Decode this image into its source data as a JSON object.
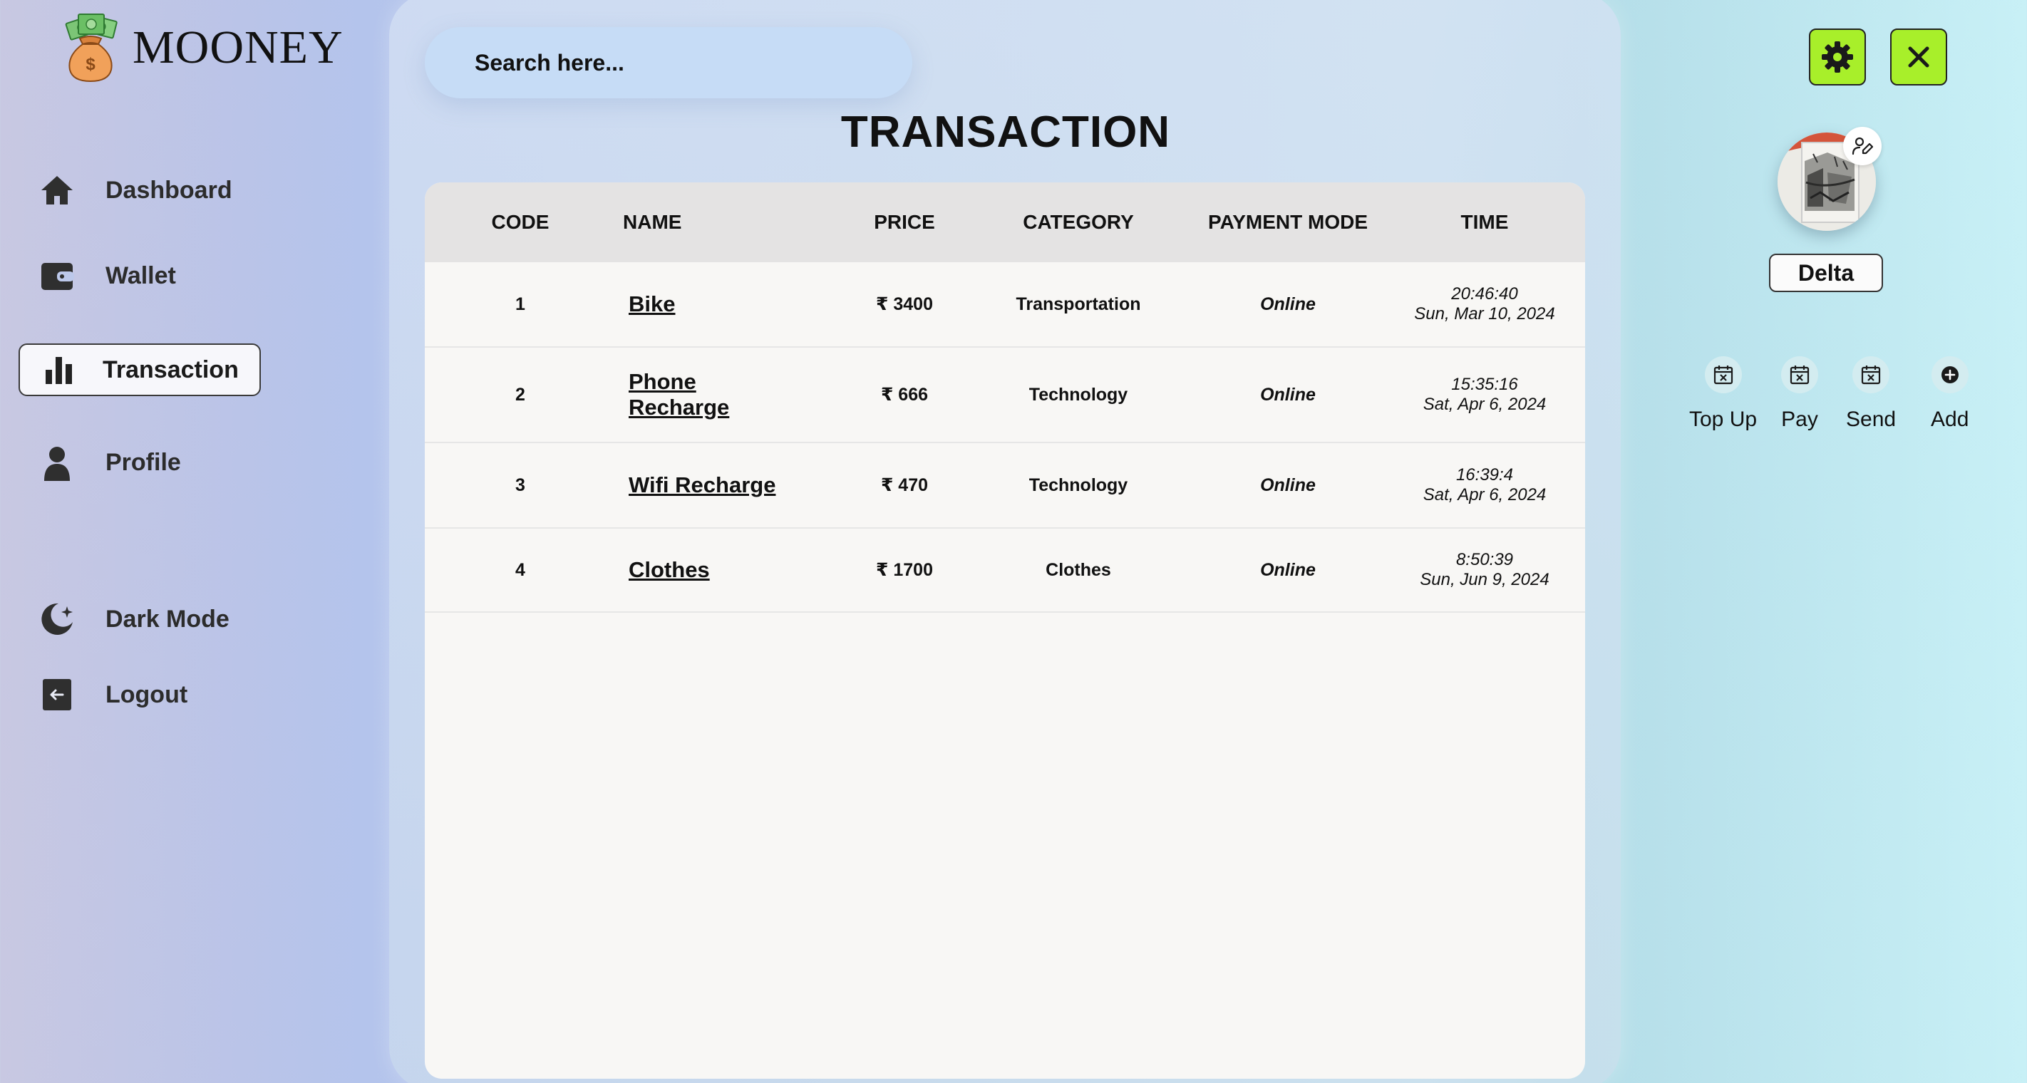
{
  "brand": {
    "name": "MOONEY"
  },
  "sidebar": {
    "items": [
      {
        "label": "Dashboard",
        "icon": "home-icon"
      },
      {
        "label": "Wallet",
        "icon": "wallet-icon"
      },
      {
        "label": "Transaction",
        "icon": "bar-chart-icon",
        "active": true
      },
      {
        "label": "Profile",
        "icon": "user-icon"
      }
    ],
    "dark_mode_label": "Dark Mode",
    "logout_label": "Logout"
  },
  "search": {
    "placeholder": "Search here..."
  },
  "page": {
    "title": "TRANSACTION"
  },
  "table": {
    "columns": [
      "CODE",
      "NAME",
      "PRICE",
      "CATEGORY",
      "PAYMENT MODE",
      "TIME"
    ],
    "rows": [
      {
        "code": "1",
        "name": "Bike",
        "price": "₹ 3400",
        "category": "Transportation",
        "payment_mode": "Online",
        "time": "20:46:40",
        "date": "Sun, Mar 10, 2024"
      },
      {
        "code": "2",
        "name": "Phone Recharge",
        "price": "₹ 666",
        "category": "Technology",
        "payment_mode": "Online",
        "time": "15:35:16",
        "date": "Sat, Apr 6, 2024"
      },
      {
        "code": "3",
        "name": "Wifi Recharge",
        "price": "₹ 470",
        "category": "Technology",
        "payment_mode": "Online",
        "time": "16:39:4",
        "date": "Sat, Apr 6, 2024"
      },
      {
        "code": "4",
        "name": "Clothes",
        "price": "₹ 1700",
        "category": "Clothes",
        "payment_mode": "Online",
        "time": "8:50:39",
        "date": "Sun, Jun 9, 2024"
      }
    ]
  },
  "profile": {
    "username": "Delta"
  },
  "quick_actions": [
    {
      "label": "Top Up",
      "icon": "calendar-x-icon"
    },
    {
      "label": "Pay",
      "icon": "calendar-x-icon"
    },
    {
      "label": "Send",
      "icon": "calendar-x-icon"
    },
    {
      "label": "Add",
      "icon": "plus-circle-icon"
    }
  ],
  "colors": {
    "accent_button": "#a8ef2a",
    "table_header": "#e4e3e3",
    "table_body": "#f8f7f5"
  }
}
